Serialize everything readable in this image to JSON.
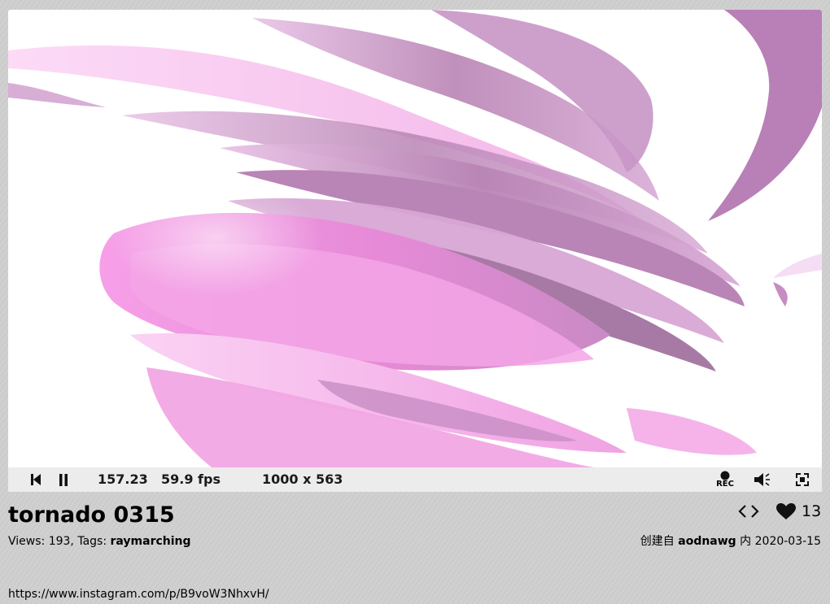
{
  "player": {
    "time": "157.23",
    "fps": "59.9 fps",
    "resolution": "1000 x 563",
    "rec_label": "REC"
  },
  "shader": {
    "title": "tornado 0315",
    "views_label": "Views:",
    "views_count": "193",
    "tags_label": "Tags:",
    "tag": "raymarching",
    "likes": "13",
    "created_prefix": "创建自",
    "author": "aodnawg",
    "date_prefix": "内",
    "date": "2020-03-15",
    "description_link": "https://www.instagram.com/p/B9voW3NhxvH/"
  },
  "icons": {
    "rewind": "skip-back-icon",
    "pause": "pause-icon",
    "record": "record-icon",
    "volume": "volume-icon",
    "fullscreen": "fullscreen-icon",
    "code": "code-brackets-icon",
    "like": "heart-icon"
  },
  "colors": {
    "canvas_bg": "#ffffff",
    "swirl_light": "#f6b6ee",
    "swirl_pink": "#f08ee0",
    "swirl_mauve": "#b884b4",
    "controls_bg": "#ececec",
    "page_bg": "#cfcfcf"
  }
}
